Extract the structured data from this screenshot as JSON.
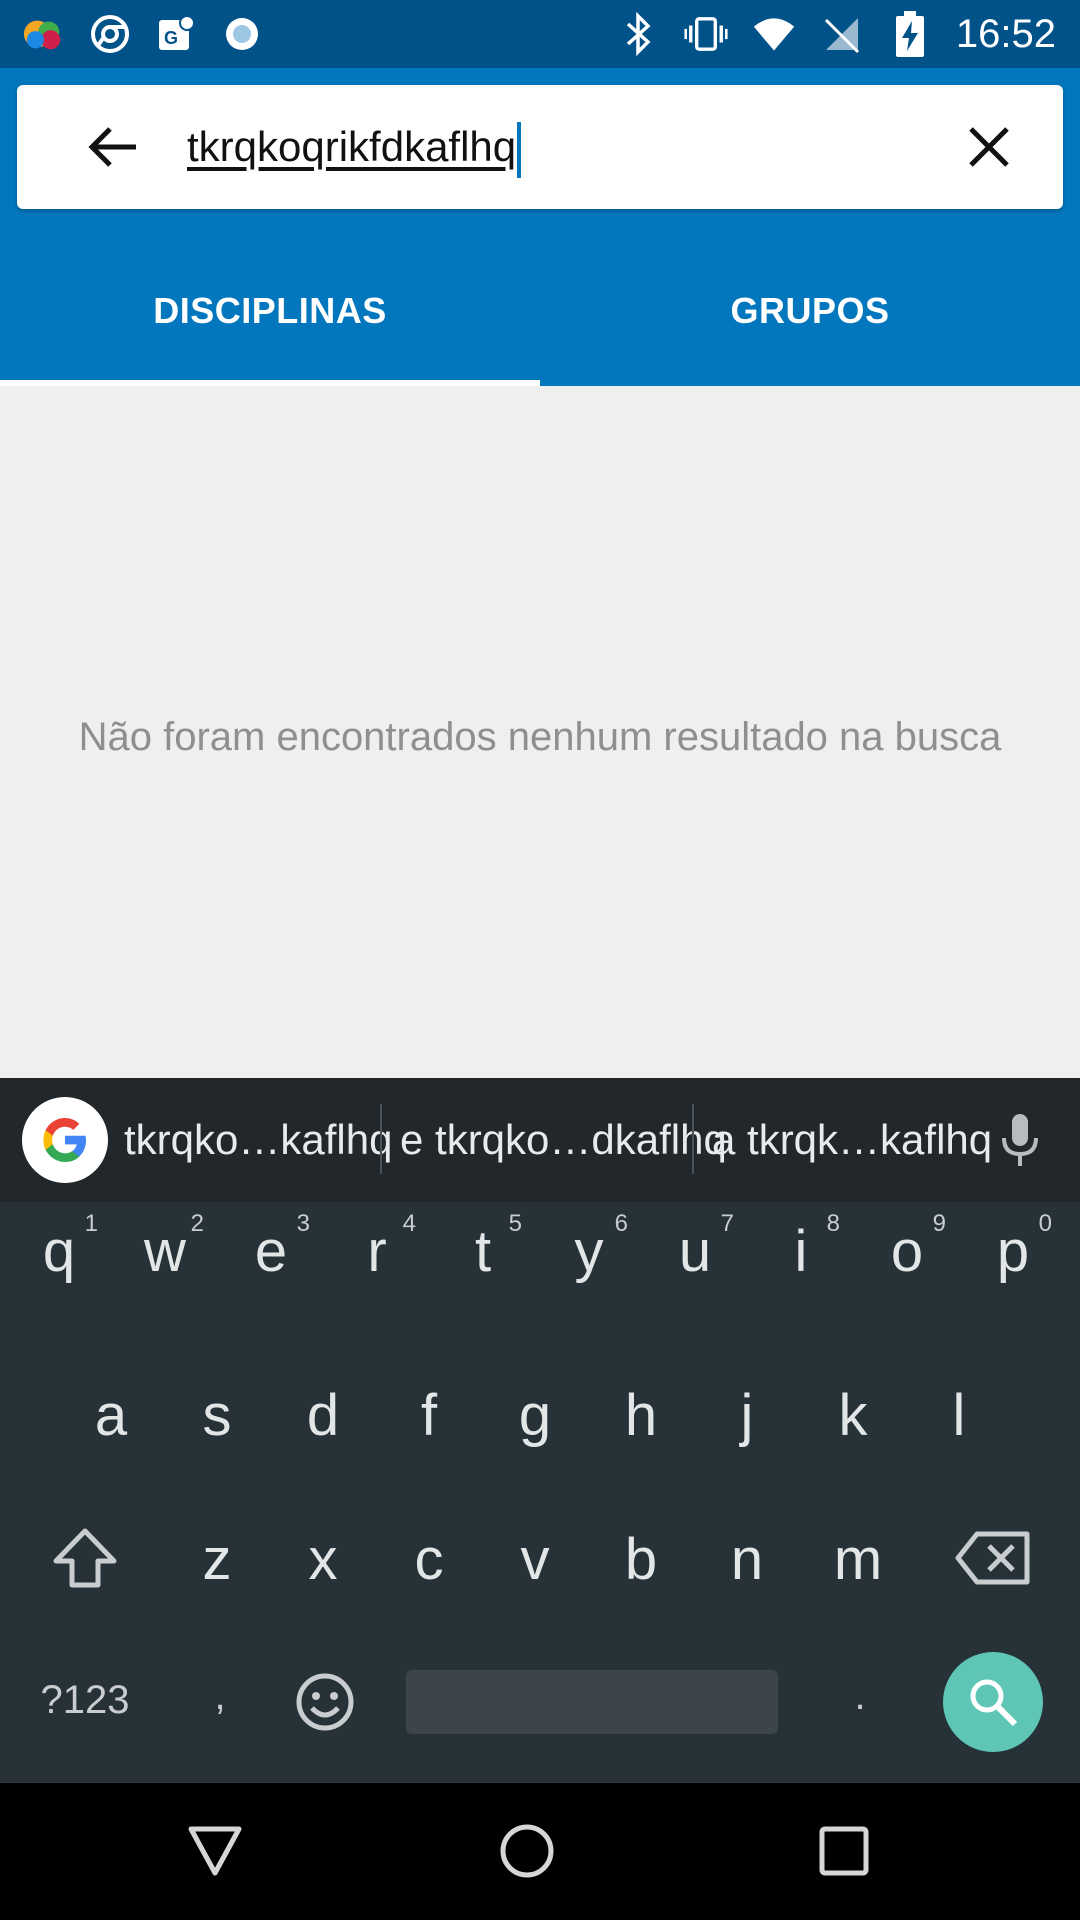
{
  "status_bar": {
    "time": "16:52",
    "left_icons": [
      "app-notification-icon",
      "chrome-icon",
      "maps-icon",
      "record-icon"
    ],
    "right_icons": [
      "bluetooth-icon",
      "vibrate-icon",
      "wifi-icon",
      "no-sim-icon",
      "battery-charging-icon"
    ]
  },
  "search": {
    "query": "tkrqkoqrikfdkaflhq"
  },
  "tabs": [
    {
      "label": "DISCIPLINAS",
      "active": true
    },
    {
      "label": "GRUPOS",
      "active": false
    }
  ],
  "results": {
    "empty_message": "Não foram encontrados nenhum resultado na busca"
  },
  "keyboard": {
    "suggestions": [
      "tkrqko…kaflhq",
      "e tkrqko…dkaflhq",
      "a tkrqk…kaflhq"
    ],
    "row1": [
      {
        "key": "q",
        "hint": "1"
      },
      {
        "key": "w",
        "hint": "2"
      },
      {
        "key": "e",
        "hint": "3"
      },
      {
        "key": "r",
        "hint": "4"
      },
      {
        "key": "t",
        "hint": "5"
      },
      {
        "key": "y",
        "hint": "6"
      },
      {
        "key": "u",
        "hint": "7"
      },
      {
        "key": "i",
        "hint": "8"
      },
      {
        "key": "o",
        "hint": "9"
      },
      {
        "key": "p",
        "hint": "0"
      }
    ],
    "row2": [
      "a",
      "s",
      "d",
      "f",
      "g",
      "h",
      "j",
      "k",
      "l"
    ],
    "row3": [
      "z",
      "x",
      "c",
      "v",
      "b",
      "n",
      "m"
    ],
    "symbols_key": "?123",
    "comma_key": ",",
    "period_key": ".",
    "accent_color": "#5fc6b6"
  },
  "colors": {
    "status_bar": "#02528a",
    "app_bar": "#0277bd",
    "background": "#efefef",
    "keyboard": "#263238"
  }
}
